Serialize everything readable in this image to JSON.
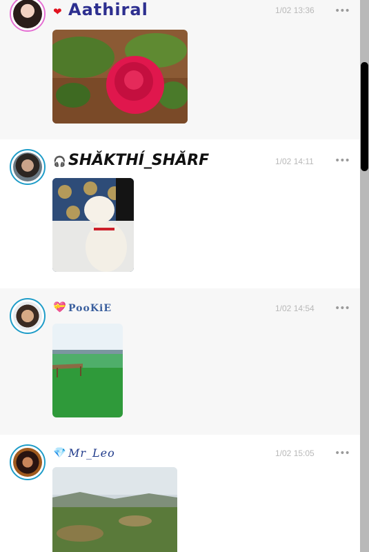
{
  "posts": [
    {
      "username": "Aathiral",
      "badge_icon": "heart-icon",
      "badge_glyph": "❤",
      "time": "1/02 13:36",
      "more": "•••",
      "photo": "rose-photo"
    },
    {
      "username": "SHĂKTHÍ_SHĂRF",
      "badge_icon": "headphones-emoji-icon",
      "badge_glyph": "🎧",
      "time": "1/02 14:11",
      "more": "•••",
      "photo": "puppy-photo"
    },
    {
      "username": "PooKiE",
      "badge_icon": "heart-ribbon-icon",
      "badge_glyph": "💝",
      "time": "1/02 14:54",
      "more": "•••",
      "photo": "lake-photo"
    },
    {
      "username": "Mr_Leo",
      "badge_icon": "diamond-icon",
      "badge_glyph": "💎",
      "time": "1/02 15:05",
      "more": "•••",
      "photo": "landscape-photo"
    }
  ],
  "colors": {
    "topbar": "#7a1a8c",
    "avatar_ring": "#1e9cc8",
    "avatar_ring_first": "#e56fd3",
    "timestamp": "#b8b8b8"
  }
}
